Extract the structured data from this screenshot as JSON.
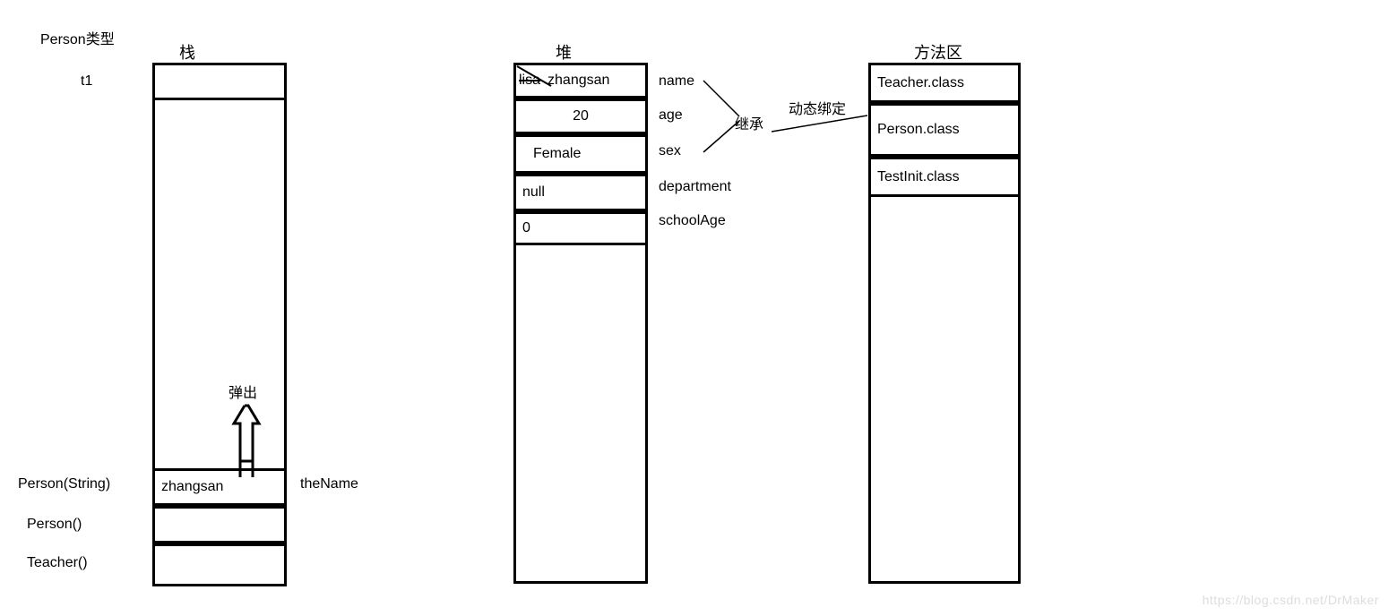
{
  "titles": {
    "stack": "栈",
    "heap": "堆",
    "method_area": "方法区"
  },
  "labels": {
    "person_type": "Person类型",
    "t1": "t1",
    "pop_out": "弹出",
    "person_string": "Person(String)",
    "person_ctor": "Person()",
    "teacher_ctor": "Teacher()",
    "the_name": "theName",
    "inherit": "继承",
    "dynamic_binding": "动态绑定"
  },
  "stack": {
    "row1_value": "zhangsan"
  },
  "heap": {
    "fields": [
      {
        "value_struck": "lisa",
        "value_new": "zhangsan",
        "field": "name"
      },
      {
        "value": "20",
        "field": "age"
      },
      {
        "value": "Female",
        "field": "sex"
      },
      {
        "value": "null",
        "field": "department"
      },
      {
        "value": "0",
        "field": "schoolAge"
      }
    ]
  },
  "method_area": {
    "classes": [
      "Teacher.class",
      "Person.class",
      "TestInit.class"
    ]
  },
  "watermark": "https://blog.csdn.net/DrMaker"
}
